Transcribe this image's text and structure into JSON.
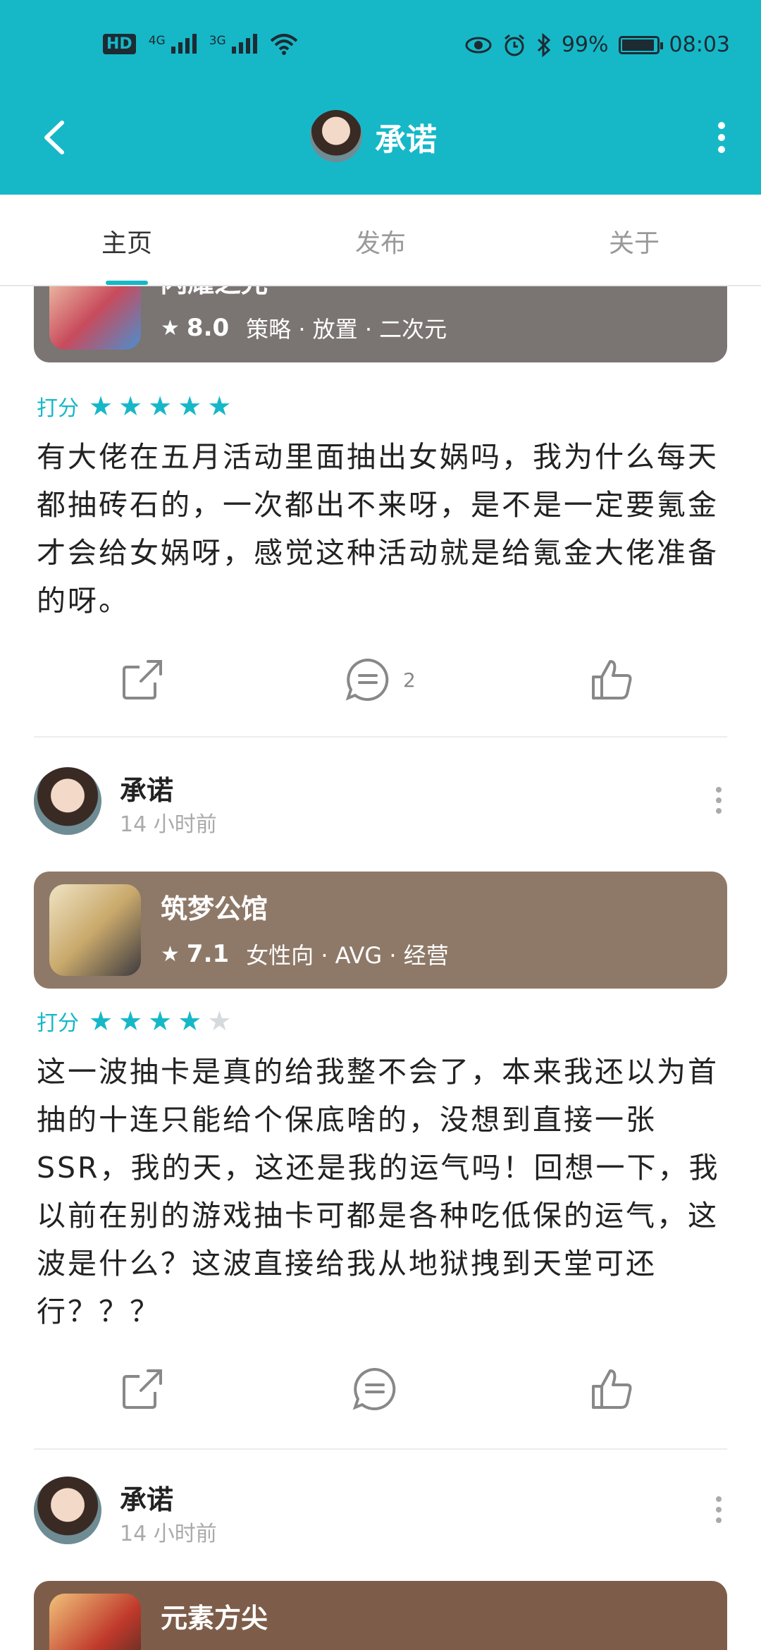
{
  "status_bar": {
    "left": {
      "hd": "HD",
      "net1": "4G",
      "net2": "3G"
    },
    "right": {
      "battery": "99%",
      "time": "08:03",
      "battery_level": 0.99
    }
  },
  "header": {
    "title": "承诺",
    "icons": {
      "back": "back-arrow-icon",
      "more": "more-vertical-icon"
    }
  },
  "tabs": [
    {
      "label": "主页",
      "active": true
    },
    {
      "label": "发布",
      "active": false
    },
    {
      "label": "关于",
      "active": false
    }
  ],
  "posts": [
    {
      "game": {
        "name": "闪耀之光",
        "score": "8.0",
        "tags": "策略 · 放置 · 二次元",
        "color": "#7a7472"
      },
      "rating_label": "打分",
      "rating": 5,
      "text": "有大佬在五月活动里面抽出女娲吗，我为什么每天都抽砖石的，一次都出不来呀，是不是一定要氪金才会给女娲呀，感觉这种活动就是给氪金大佬准备的呀。",
      "actions": {
        "share": "share-icon",
        "comment_count": "2",
        "like": "like-icon"
      }
    },
    {
      "author": {
        "name": "承诺",
        "time": "14 小时前"
      },
      "game": {
        "name": "筑梦公馆",
        "score": "7.1",
        "tags": "女性向 · AVG · 经营",
        "color": "#8e7968"
      },
      "rating_label": "打分",
      "rating": 4,
      "text": "这一波抽卡是真的给我整不会了，本来我还以为首抽的十连只能给个保底啥的，没想到直接一张SSR，我的天，这还是我的运气吗！回想一下，我以前在别的游戏抽卡可都是各种吃低保的运气，这波是什么？这波直接给我从地狱拽到天堂可还行？？？",
      "actions": {
        "share": "share-icon",
        "comment_count": "",
        "like": "like-icon"
      }
    },
    {
      "author": {
        "name": "承诺",
        "time": "14 小时前"
      },
      "game": {
        "name": "元素方尖",
        "color": "#7d5d4a"
      }
    }
  ]
}
